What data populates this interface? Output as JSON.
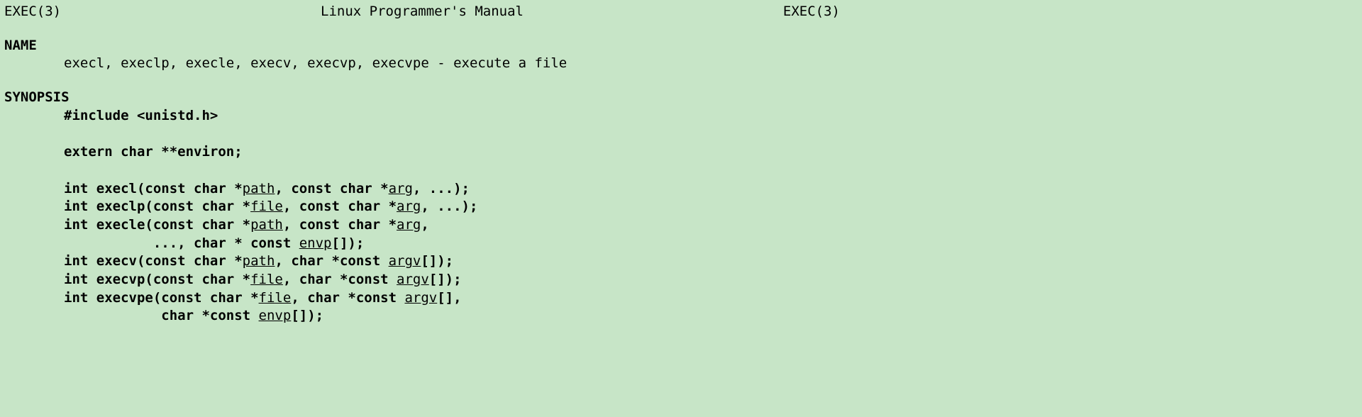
{
  "header": {
    "left": "EXEC(3)",
    "center": "Linux Programmer's Manual",
    "right": "EXEC(3)"
  },
  "sections": {
    "name": {
      "title": "NAME",
      "text": "execl, execlp, execle, execv, execvp, execvpe - execute a file"
    },
    "synopsis": {
      "title": "SYNOPSIS",
      "include": "#include <unistd.h>",
      "extern": "extern char **environ;",
      "sigs": {
        "execl_pre": "int execl(const char *",
        "execl_path": "path",
        "execl_mid": ", const char *",
        "execl_arg": "arg",
        "execl_post": ", ...);",
        "execlp_pre": "int execlp(const char *",
        "execlp_file": "file",
        "execlp_mid": ", const char *",
        "execlp_arg": "arg",
        "execlp_post": ", ...);",
        "execle_pre": "int execle(const char *",
        "execle_path": "path",
        "execle_mid": ", const char *",
        "execle_arg": "arg",
        "execle_post": ",",
        "execle2_pre": "           ..., char * const ",
        "execle2_envp": "envp",
        "execle2_post": "[]);",
        "execv_pre": "int execv(const char *",
        "execv_path": "path",
        "execv_mid": ", char *const ",
        "execv_argv": "argv",
        "execv_post": "[]);",
        "execvp_pre": "int execvp(const char *",
        "execvp_file": "file",
        "execvp_mid": ", char *const ",
        "execvp_argv": "argv",
        "execvp_post": "[]);",
        "execvpe_pre": "int execvpe(const char *",
        "execvpe_file": "file",
        "execvpe_mid": ", char *const ",
        "execvpe_argv": "argv",
        "execvpe_post": "[],",
        "execvpe2_pre": "            char *const ",
        "execvpe2_envp": "envp",
        "execvpe2_post": "[]);"
      }
    }
  }
}
